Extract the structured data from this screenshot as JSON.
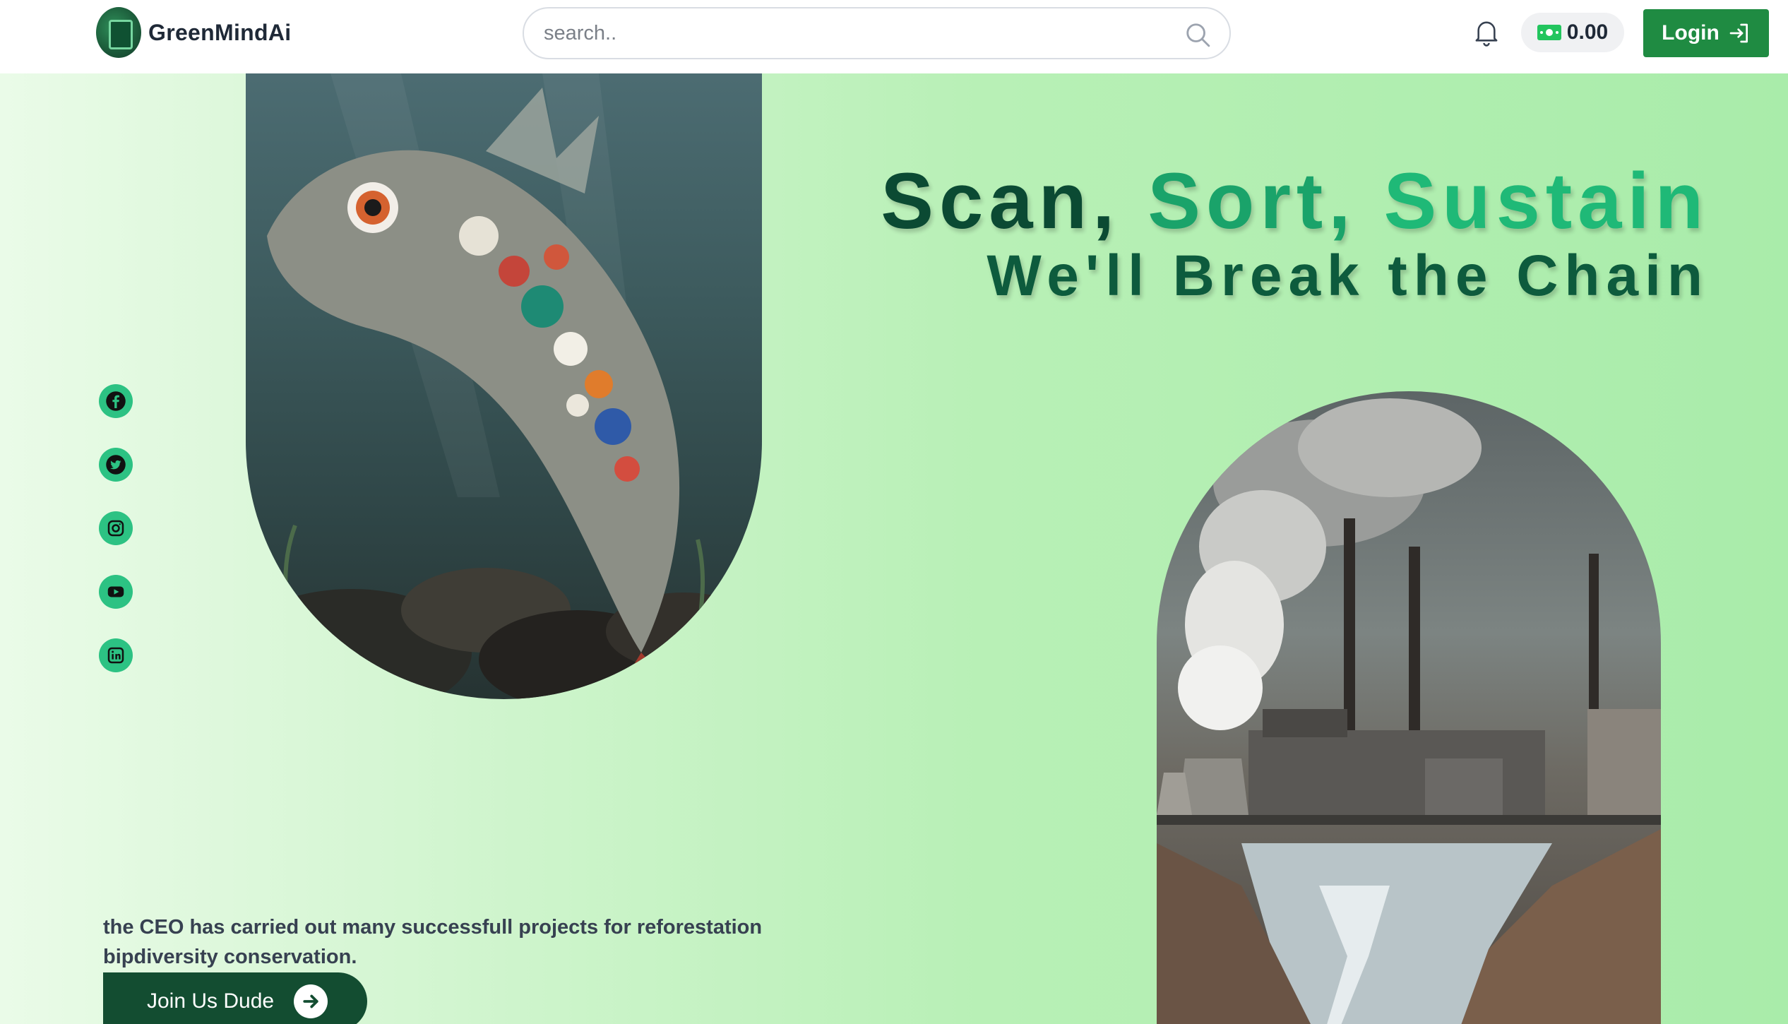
{
  "header": {
    "brand": "GreenMindAi",
    "search": {
      "placeholder": "search..",
      "value": ""
    },
    "wallet": {
      "amount": "0.00"
    },
    "login_label": "Login"
  },
  "hero": {
    "headline_words": [
      "Scan,",
      "Sort,",
      "Sustain"
    ],
    "subheadline": "We'll Break the Chain",
    "description": "the CEO has carried out many successfull projects for reforestation bipdiversity conservation.",
    "cta_label": "Join Us Dude"
  },
  "social_links": [
    "facebook-icon",
    "twitter-icon",
    "instagram-icon",
    "youtube-icon",
    "linkedin-icon"
  ],
  "colors": {
    "brand_green": "#1f8b42",
    "dark_green": "#134d31",
    "accent_green": "#2cc283",
    "headline_dark": "#0b4a33",
    "headline_light": "#1fb977"
  }
}
